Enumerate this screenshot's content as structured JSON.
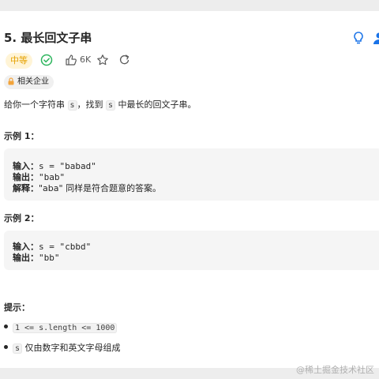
{
  "problem": {
    "title": "5. 最长回文子串",
    "difficulty": "中等",
    "likes": "6K",
    "company_tag": "相关企业"
  },
  "description": {
    "p1": "给你一个字符串 ",
    "code1": "s",
    "p2": "，找到 ",
    "code2": "s",
    "p3": " 中最长的回文子串。"
  },
  "examples": [
    {
      "title": "示例 1：",
      "input_label": "输入：",
      "input_value": "s = \"babad\"",
      "output_label": "输出：",
      "output_value": "\"bab\"",
      "explain_label": "解释：",
      "explain_value": "\"aba\" 同样是符合题意的答案。"
    },
    {
      "title": "示例 2：",
      "input_label": "输入：",
      "input_value": "s = \"cbbd\"",
      "output_label": "输出：",
      "output_value": "\"bb\""
    }
  ],
  "hints": {
    "title": "提示：",
    "items": [
      {
        "code": "1 <= s.length <= 1000",
        "text": ""
      },
      {
        "code": "s",
        "text": " 仅由数字和英文字母组成"
      }
    ]
  },
  "watermark": "@稀土掘金技术社区"
}
